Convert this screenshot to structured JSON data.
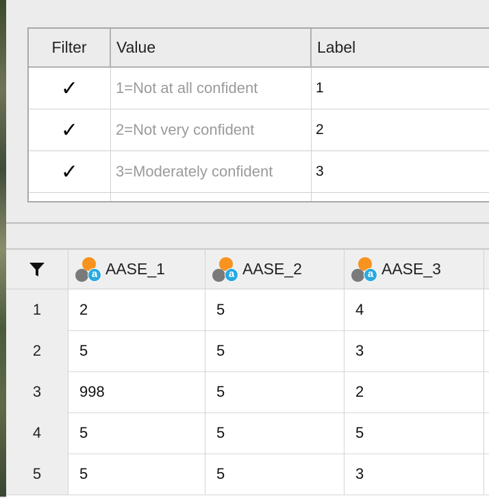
{
  "label_table": {
    "columns": [
      "Filter",
      "Value",
      "Label"
    ],
    "rows": [
      {
        "filter": "✓",
        "value": "1=Not at all confident",
        "label": "1"
      },
      {
        "filter": "✓",
        "value": "2=Not very confident",
        "label": "2"
      },
      {
        "filter": "✓",
        "value": "3=Moderately confident",
        "label": "3"
      }
    ]
  },
  "grid": {
    "filter_icon": "filter-funnel-icon",
    "variable_icon": "variable-type-icon",
    "columns": [
      "AASE_1",
      "AASE_2",
      "AASE_3"
    ],
    "icon_letter": "a",
    "rows": [
      {
        "index": "1",
        "values": [
          "2",
          "5",
          "4"
        ]
      },
      {
        "index": "2",
        "values": [
          "5",
          "5",
          "3"
        ]
      },
      {
        "index": "3",
        "values": [
          "998",
          "5",
          "2"
        ]
      },
      {
        "index": "4",
        "values": [
          "5",
          "5",
          "5"
        ]
      },
      {
        "index": "5",
        "values": [
          "5",
          "5",
          "3"
        ]
      }
    ]
  },
  "colors": {
    "accent_orange": "#f7931e",
    "accent_blue": "#2aa9e0",
    "inactive_value_text": "#9a9a9a"
  }
}
